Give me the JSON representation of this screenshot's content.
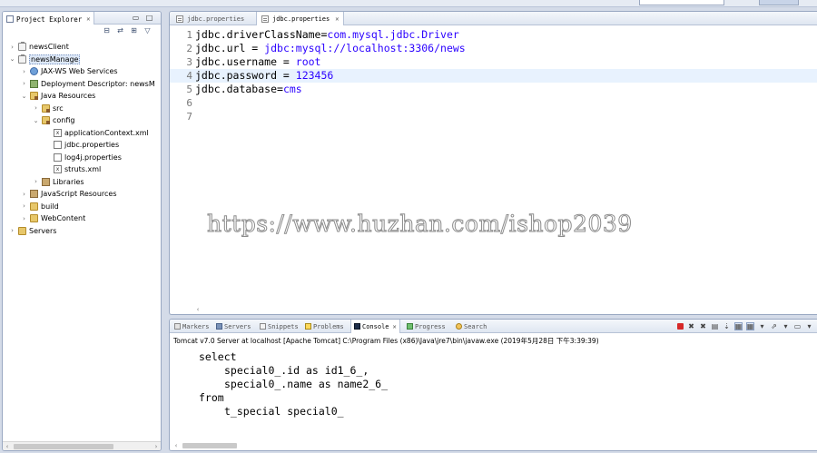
{
  "explorer": {
    "tab_label": "Project Explorer",
    "close_glyph": "✕",
    "minimize_glyph": "▭",
    "maximize_glyph": "□",
    "tree": [
      {
        "label": "newsClient",
        "twisty": "›",
        "icon": "project",
        "depth": 0
      },
      {
        "label": "newsManage",
        "twisty": "⌄",
        "icon": "project",
        "depth": 0,
        "selected": true
      },
      {
        "label": "JAX-WS Web Services",
        "twisty": "›",
        "icon": "ws",
        "depth": 1
      },
      {
        "label": "Deployment Descriptor: newsM",
        "twisty": "›",
        "icon": "dd",
        "depth": 1
      },
      {
        "label": "Java Resources",
        "twisty": "⌄",
        "icon": "pkgfolder",
        "depth": 1
      },
      {
        "label": "src",
        "twisty": "›",
        "icon": "pkgfolder",
        "depth": 2
      },
      {
        "label": "config",
        "twisty": "⌄",
        "icon": "pkgfolder",
        "depth": 2
      },
      {
        "label": "applicationContext.xml",
        "twisty": "",
        "icon": "xml",
        "depth": 3
      },
      {
        "label": "jdbc.properties",
        "twisty": "",
        "icon": "file",
        "depth": 3
      },
      {
        "label": "log4j.properties",
        "twisty": "",
        "icon": "file",
        "depth": 3
      },
      {
        "label": "struts.xml",
        "twisty": "",
        "icon": "xml",
        "depth": 3
      },
      {
        "label": "Libraries",
        "twisty": "›",
        "icon": "lib",
        "depth": 2
      },
      {
        "label": "JavaScript Resources",
        "twisty": "›",
        "icon": "lib",
        "depth": 1
      },
      {
        "label": "build",
        "twisty": "›",
        "icon": "folder",
        "depth": 1
      },
      {
        "label": "WebContent",
        "twisty": "›",
        "icon": "folder",
        "depth": 1
      },
      {
        "label": "Servers",
        "twisty": "›",
        "icon": "folder",
        "depth": 0
      }
    ]
  },
  "editor": {
    "tabs": [
      {
        "label": "jdbc.properties",
        "active": false
      },
      {
        "label": "jdbc.properties",
        "active": true
      }
    ],
    "lines": [
      {
        "num": "1",
        "key": "jdbc.driverClassName=",
        "value": "com.mysql.jdbc.Driver"
      },
      {
        "num": "2",
        "key": "jdbc.url = ",
        "value": "jdbc:mysql://localhost:3306/news"
      },
      {
        "num": "3",
        "key": "jdbc.username = ",
        "value": "root"
      },
      {
        "num": "4",
        "key": "jdbc.password = ",
        "value": "123456",
        "current": true
      },
      {
        "num": "5",
        "key": "jdbc.database=",
        "value": "cms"
      },
      {
        "num": "6",
        "key": "",
        "value": ""
      },
      {
        "num": "7",
        "key": "",
        "value": ""
      }
    ],
    "scroll_left_glyph": "‹"
  },
  "watermark": "https://www.huzhan.com/ishop2039",
  "console": {
    "tabs": [
      {
        "label": "Markers",
        "icon": "c-markers"
      },
      {
        "label": "Servers",
        "icon": "c-servers"
      },
      {
        "label": "Snippets",
        "icon": "c-snip"
      },
      {
        "label": "Problems",
        "icon": "c-prob"
      },
      {
        "label": "Console",
        "icon": "c-cons",
        "active": true
      },
      {
        "label": "Progress",
        "icon": "c-prog"
      },
      {
        "label": "Search",
        "icon": "c-search"
      }
    ],
    "header": "Tomcat v7.0 Server at localhost [Apache Tomcat] C:\\Program Files (x86)\\Java\\jre7\\bin\\javaw.exe (2019年5月28日 下午3:39:39)",
    "output": [
      {
        "text": "select",
        "indent": 1
      },
      {
        "text": "special0_.id as id1_6_,",
        "indent": 2
      },
      {
        "text": "special0_.name as name2_6_",
        "indent": 2
      },
      {
        "text": "from",
        "indent": 1
      },
      {
        "text": "t_special special0_",
        "indent": 2
      }
    ]
  }
}
